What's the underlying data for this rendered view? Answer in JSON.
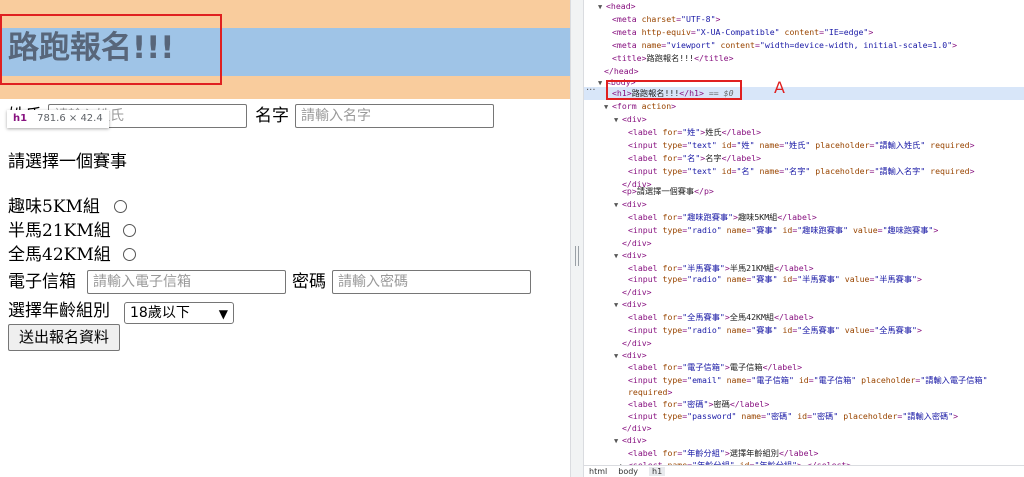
{
  "preview": {
    "heading": "路跑報名!!!",
    "tooltip": {
      "tag": "h1",
      "dims": "781.6 × 42.4"
    },
    "last_name": {
      "label": "姓氏",
      "placeholder": "請輸入姓氏"
    },
    "first_name": {
      "label": "名字",
      "placeholder": "請輸入名字"
    },
    "choose_event": "請選擇一個賽事",
    "events": [
      "趣味5KM組",
      "半馬21KM組",
      "全馬42KM組"
    ],
    "email": {
      "label": "電子信箱",
      "placeholder": "請輸入電子信箱"
    },
    "password": {
      "label": "密碼",
      "placeholder": "請輸入密碼"
    },
    "age_group": {
      "label": "選擇年齡組別",
      "selected": "18歲以下"
    },
    "submit": "送出報名資料"
  },
  "annotation_label": "A",
  "breadcrumb": [
    "html",
    "body",
    "h1"
  ],
  "colors": {
    "highlight_content": "#9fc4e7",
    "highlight_margin": "#f9cc9d",
    "annotation_red": "#e02020"
  }
}
